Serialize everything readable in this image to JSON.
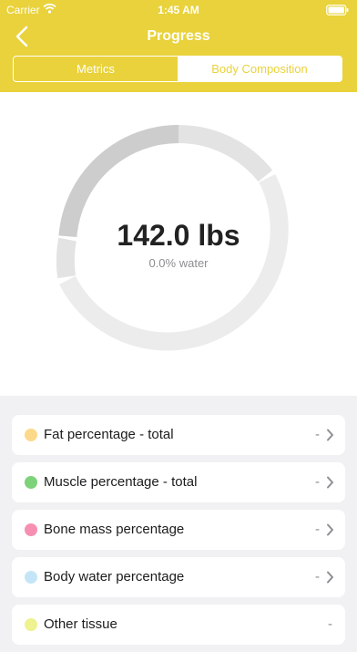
{
  "status_bar": {
    "carrier": "Carrier",
    "time": "1:45 AM"
  },
  "nav": {
    "title": "Progress"
  },
  "segments": [
    {
      "label": "Metrics",
      "selected": true
    },
    {
      "label": "Body Composition",
      "selected": false
    }
  ],
  "summary": {
    "value": "142.0 lbs",
    "subtitle": "0.0% water"
  },
  "composition": [
    {
      "label": "Fat percentage - total",
      "value": "-",
      "color": "#fcd98a"
    },
    {
      "label": "Muscle percentage - total",
      "value": "-",
      "color": "#7dd27a"
    },
    {
      "label": "Bone mass percentage",
      "value": "-",
      "color": "#f78fb3"
    },
    {
      "label": "Body water percentage",
      "value": "-",
      "color": "#c4e5f8"
    },
    {
      "label": "Other tissue",
      "value": "-",
      "color": "#eef28f"
    }
  ],
  "colors": {
    "accent": "#e9d23b",
    "ring_light": "#ececec",
    "ring_mid": "#e3e3e3",
    "ring_dark": "#cdcdcd"
  }
}
